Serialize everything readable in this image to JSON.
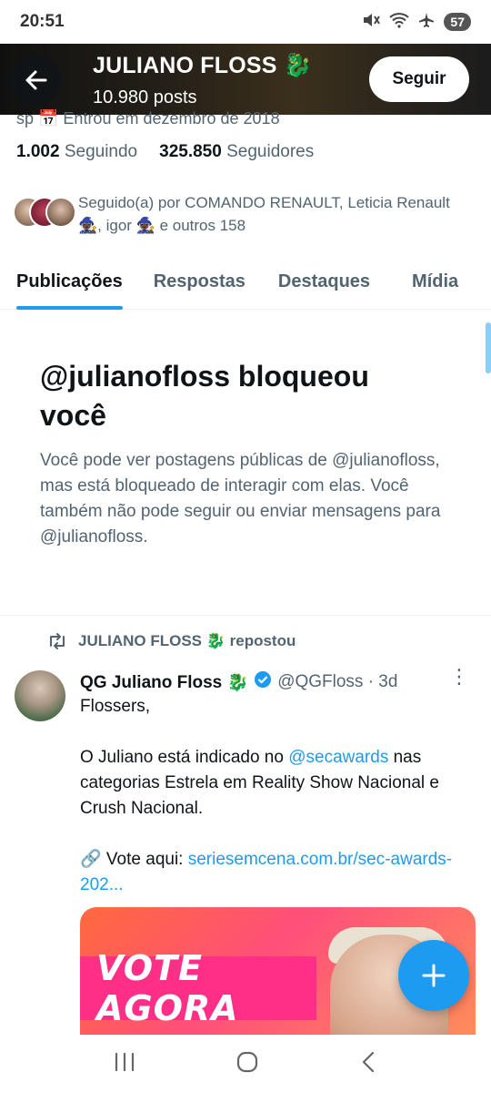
{
  "status_bar": {
    "time": "20:51",
    "battery": "57"
  },
  "header": {
    "name": "JULIANO FLOSS",
    "name_emoji": "🐉",
    "posts": "10.980 posts",
    "follow_label": "Seguir"
  },
  "profile": {
    "partial_line": "sp   📅 Entrou em dezembro de 2018",
    "following_count": "1.002",
    "following_label": "Seguindo",
    "followers_count": "325.850",
    "followers_label": "Seguidores",
    "followed_by": "Seguido(a) por COMANDO RENAULT, Leticia Renault 🧙🏿‍♀️, igor 🧙🏿‍♀️ e outros 158"
  },
  "tabs": [
    {
      "label": "Publicações",
      "active": true
    },
    {
      "label": "Respostas",
      "active": false
    },
    {
      "label": "Destaques",
      "active": false
    },
    {
      "label": "Mídia",
      "active": false
    }
  ],
  "blocked": {
    "title": "@julianofloss bloqueou você",
    "body": "Você pode ver postagens públicas de @julianofloss, mas está bloqueado de interagir com elas. Você também não pode seguir ou enviar mensagens para @julianofloss."
  },
  "tweet": {
    "repost_text": "JULIANO FLOSS 🐉 repostou",
    "author_name": "QG Juliano Floss 🐉",
    "handle_time": "@QGFloss · 3d",
    "line1": "Flossers,",
    "line2_pre": "O Juliano está indicado no ",
    "line2_mention": "@secawards",
    "line2_post": " nas categorias Estrela em Reality Show Nacional e Crush Nacional.",
    "line3_pre": "🔗 Vote aqui: ",
    "line3_link": "seriesemcena.com.br/sec-awards-202...",
    "media_text": "VOTE AGORA"
  },
  "colors": {
    "accent": "#1d9bf0",
    "text": "#0f1419",
    "secondary": "#536471"
  }
}
